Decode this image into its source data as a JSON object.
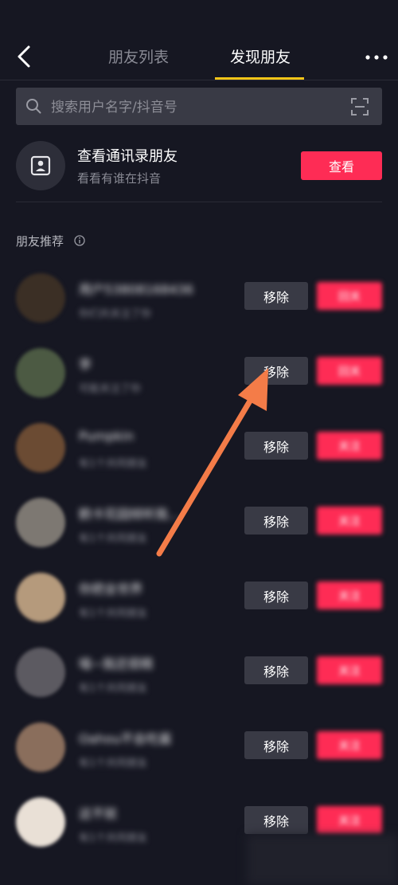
{
  "nav": {
    "tabs": [
      {
        "label": "朋友列表"
      },
      {
        "label": "发现朋友"
      }
    ]
  },
  "search": {
    "placeholder": "搜索用户名字/抖音号"
  },
  "contacts": {
    "title": "查看通讯录朋友",
    "subtitle": "看看有谁在抖音",
    "button_label": "查看"
  },
  "section": {
    "title": "朋友推荐"
  },
  "friends": [
    {
      "name": "用户5380816843​6",
      "sub": "你们共关注了你",
      "remove_label": "移除",
      "follow_label": "回关",
      "avatar_color": "#3b2f25"
    },
    {
      "name": "李",
      "sub": "可能关注了你",
      "remove_label": "移除",
      "follow_label": "回关",
      "avatar_color": "#4c5a43"
    },
    {
      "name": "Pumpkin",
      "sub": "有1个共同朋友",
      "remove_label": "移除",
      "follow_label": "关注",
      "avatar_color": "#6b4b33"
    },
    {
      "name": "鹤卡花园倾听我…",
      "sub": "有1个共同朋友",
      "remove_label": "移除",
      "follow_label": "关注",
      "avatar_color": "#7d7872"
    },
    {
      "name": "你把全世界",
      "sub": "有1个共同朋友",
      "remove_label": "移除",
      "follow_label": "关注",
      "avatar_color": "#b59a7c"
    },
    {
      "name": "喵~我还很精",
      "sub": "有1个共同朋友",
      "remove_label": "移除",
      "follow_label": "关注",
      "avatar_color": "#5c5a61"
    },
    {
      "name": "Oahou不会吃酱",
      "sub": "有1个共同朋友",
      "remove_label": "移除",
      "follow_label": "关注",
      "avatar_color": "#8a6e5c"
    },
    {
      "name": "这不就",
      "sub": "有1个共同朋友",
      "remove_label": "移除",
      "follow_label": "关注",
      "avatar_color": "#e9e0d6"
    }
  ],
  "colors": {
    "background": "#161722",
    "accent": "#fe2c55",
    "tab_indicator": "#f5c518",
    "annotation_arrow": "#f47c48"
  },
  "icons": [
    "back-arrow-icon",
    "more-icon",
    "search-icon",
    "scan-icon",
    "contacts-card-icon",
    "info-icon",
    "annotation-arrow-icon"
  ]
}
